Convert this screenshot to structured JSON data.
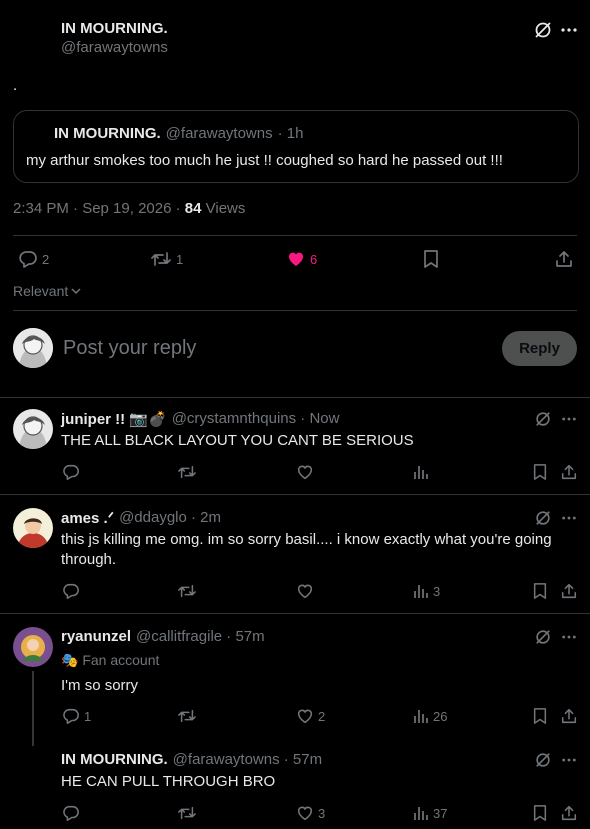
{
  "main_tweet": {
    "name": "IN MOURNING.",
    "handle": "@farawaytowns",
    "text": ".",
    "timestamp": "2:34 PM · Sep 19, 2026 · ",
    "views_count": "84",
    "views_label": " Views",
    "replies": "2",
    "retweets": "1",
    "likes": "6"
  },
  "quoted_tweet": {
    "name": "IN MOURNING.",
    "handle": "@farawaytowns",
    "time": "· 1h",
    "text": "my arthur smokes too much he just !! coughed so hard he passed out !!!"
  },
  "sort_label": "Relevant",
  "composer": {
    "placeholder": "Post your reply",
    "reply_button": "Reply"
  },
  "replies": [
    {
      "name": "juniper !! 📷💣",
      "handle": "@crystamnthquins · Now",
      "text": "THE ALL BLACK LAYOUT YOU CANT BE SERIOUS",
      "replies": "",
      "retweets": "",
      "likes": "",
      "views": ""
    },
    {
      "name": "ames .ᐟ",
      "handle": "@ddayglo · 2m",
      "text": "this js killing me omg. im so sorry basil.... i know exactly what you're going through.",
      "replies": "",
      "retweets": "",
      "likes": "",
      "views": "3"
    },
    {
      "name": "ryanunzel",
      "handle": "@callitfragile · 57m",
      "badge": "🎭 Fan account",
      "text": "I'm so sorry",
      "replies": "1",
      "retweets": "",
      "likes": "2",
      "views": "26"
    },
    {
      "name": "IN MOURNING.",
      "handle": "@farawaytowns · 57m",
      "text": "HE CAN PULL THROUGH BRO",
      "replies": "",
      "retweets": "",
      "likes": "3",
      "views": "37"
    }
  ],
  "colors": {
    "background": "#000000",
    "text": "#e7e9ea",
    "muted": "#71767b",
    "border": "#2f3336",
    "like_pink": "#f91880",
    "button_bg": "#333639"
  },
  "icons": [
    "grok-icon",
    "more-icon",
    "reply-icon",
    "retweet-icon",
    "heart-icon",
    "bookmark-icon",
    "share-icon",
    "views-icon",
    "chevron-down-icon"
  ]
}
